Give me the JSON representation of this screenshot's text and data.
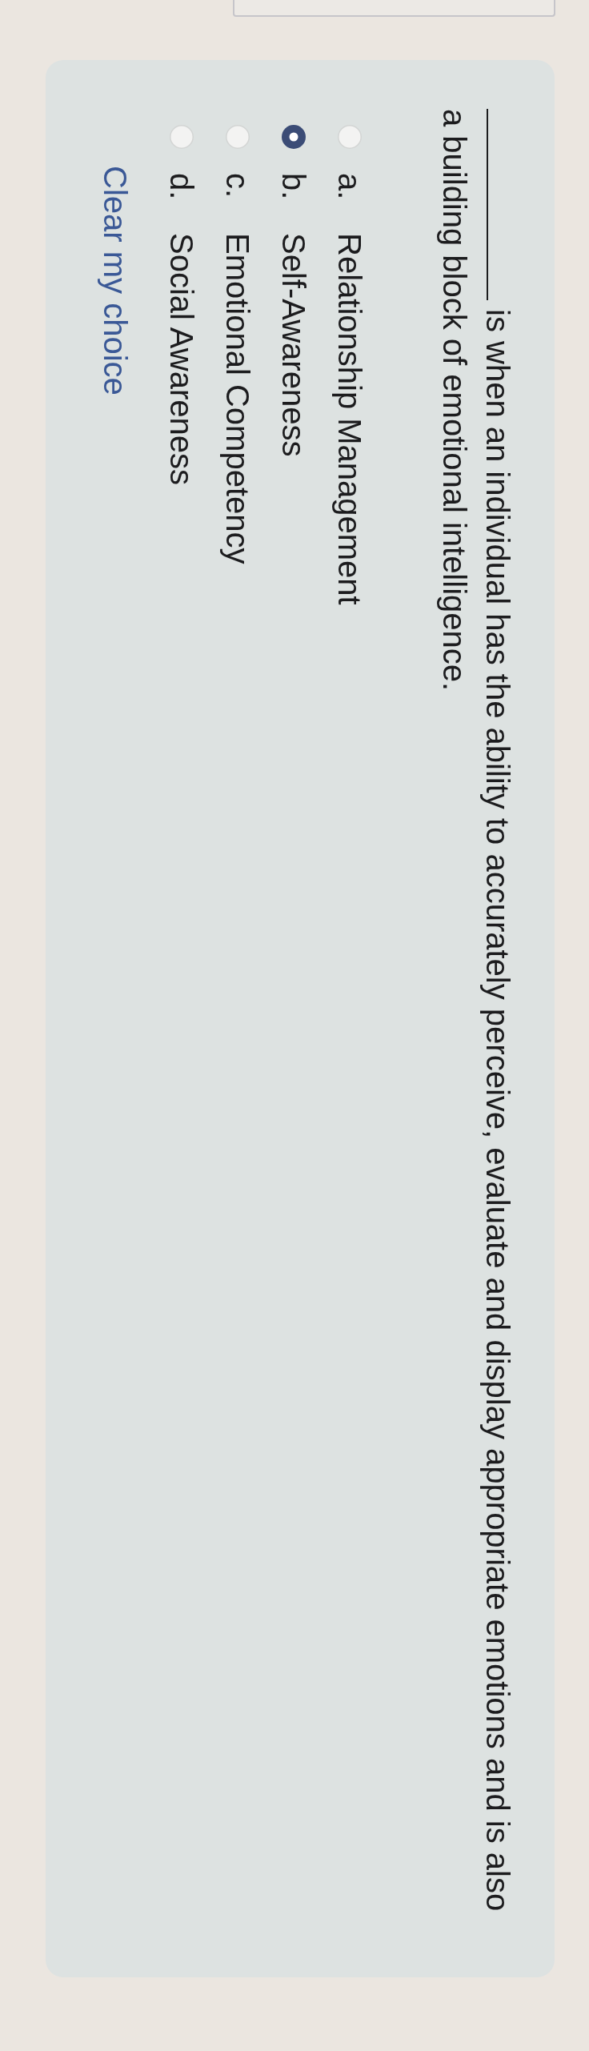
{
  "question": {
    "blank": true,
    "text": "is when an individual has the ability to accurately perceive, evaluate and display appropriate emotions and is also a building block of emotional intelligence."
  },
  "options": [
    {
      "letter": "a.",
      "label": "Relationship Management",
      "selected": false
    },
    {
      "letter": "b.",
      "label": "Self-Awareness",
      "selected": true
    },
    {
      "letter": "c.",
      "label": "Emotional Competency",
      "selected": false
    },
    {
      "letter": "d.",
      "label": "Social Awareness",
      "selected": false
    }
  ],
  "clear_link": "Clear my choice"
}
